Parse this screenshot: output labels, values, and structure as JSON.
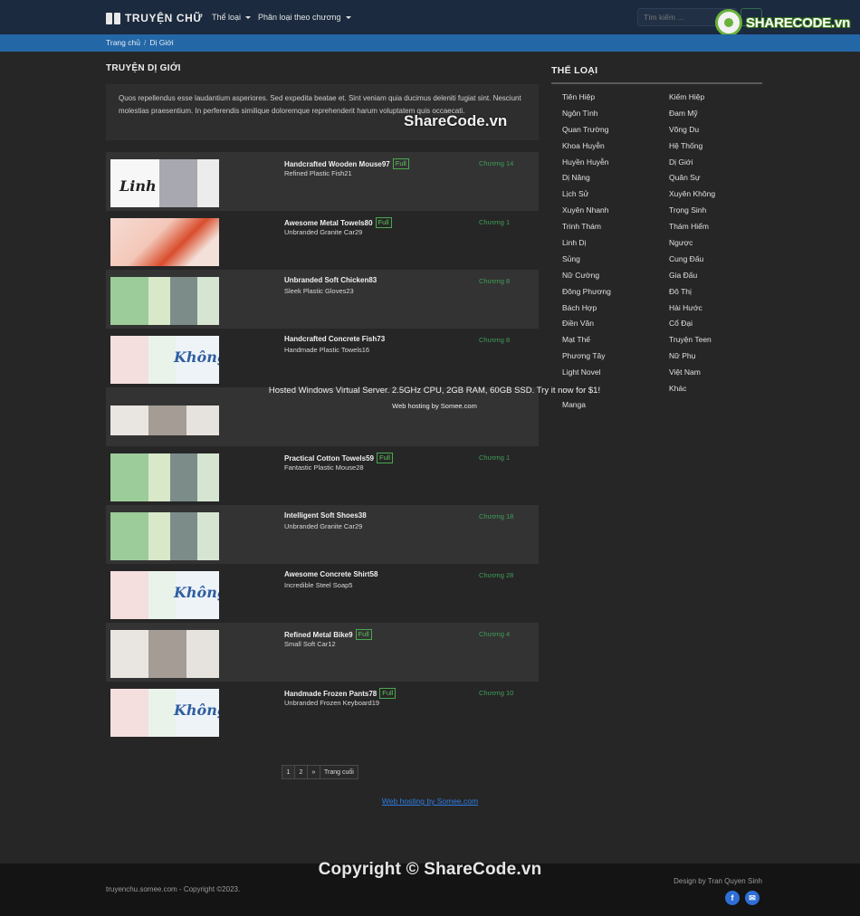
{
  "navbar": {
    "brand": "TRUYỆN CHỮ",
    "menu": [
      {
        "label": "Thể loại"
      },
      {
        "label": "Phân loại theo chương"
      }
    ],
    "search_placeholder": "Tìm kiếm ..."
  },
  "watermark": {
    "logo_text": "SHARECODE.vn",
    "mid_text": "ShareCode.vn",
    "copyright_text": "Copyright © ShareCode.vn"
  },
  "breadcrumb": [
    "Trang chủ",
    "Dị Giới"
  ],
  "page": {
    "title": "TRUYỆN DỊ GIỚI",
    "description": "Quos repellendus esse laudantium asperiores. Sed expedita beatae et. Sint veniam quia ducimus deleniti fugiat sint. Nesciunt molestias praesentium. In perferendis similique doloremque reprehenderit harum voluptatem quis occaecati."
  },
  "stories": [
    {
      "name": "Handcrafted Wooden Mouse97",
      "full": "Full",
      "author": "Refined Plastic Fish21",
      "chapter": "Chương 14"
    },
    {
      "name": "Awesome Metal Towels80",
      "full": "Full",
      "author": "Unbranded Granite Car29",
      "chapter": "Chương 1"
    },
    {
      "name": "Unbranded Soft Chicken83",
      "full": "",
      "author": "Sleek Plastic Gloves23",
      "chapter": "Chương 8"
    },
    {
      "name": "Handcrafted Concrete Fish73",
      "full": "",
      "author": "Handmade Plastic Towels16",
      "chapter": "Chương 8"
    },
    {
      "name": "",
      "full": "",
      "author": "",
      "chapter": ""
    },
    {
      "name": "Practical Cotton Towels59",
      "full": "Full",
      "author": "Fantastic Plastic Mouse28",
      "chapter": "Chương 1"
    },
    {
      "name": "Intelligent Soft Shoes38",
      "full": "",
      "author": "Unbranded Granite Car29",
      "chapter": "Chương 18"
    },
    {
      "name": "Awesome Concrete Shirt58",
      "full": "",
      "author": "Incredible Steel Soap5",
      "chapter": "Chương 28"
    },
    {
      "name": "Refined Metal Bike9",
      "full": "Full",
      "author": "Small Soft Car12",
      "chapter": "Chương 4"
    },
    {
      "name": "Handmade Frozen Pants78",
      "full": "Full",
      "author": "Unbranded Frozen Keyboard19",
      "chapter": "Chương 10"
    }
  ],
  "hosting": {
    "banner": "Hosted Windows Virtual Server. 2.5GHz CPU, 2GB RAM, 60GB SSD. Try it now for $1!",
    "sub": "Web hosting by Somee.com",
    "footer_link": "Web hosting by Somee.com"
  },
  "pagination": [
    "1",
    "2",
    "»",
    "Trang cuối"
  ],
  "sidebar": {
    "title": "THỂ LOẠI",
    "genres": [
      "Tiên Hiệp",
      "Kiếm Hiệp",
      "Ngôn Tình",
      "Đam Mỹ",
      "Quan Trường",
      "Võng Du",
      "Khoa Huyễn",
      "Hệ Thống",
      "Huyền Huyễn",
      "Dị Giới",
      "Dị Năng",
      "Quân Sự",
      "Lịch Sử",
      "Xuyên Không",
      "Xuyên Nhanh",
      "Trọng Sinh",
      "Trinh Thám",
      "Thám Hiểm",
      "Linh Dị",
      "Ngược",
      "Sủng",
      "Cung Đấu",
      "Nữ Cường",
      "Gia Đấu",
      "Đông Phương",
      "Đô Thị",
      "Bách Hợp",
      "Hài Hước",
      "Điền Văn",
      "Cổ Đại",
      "Mạt Thế",
      "Truyện Teen",
      "Phương Tây",
      "Nữ Phụ",
      "Light Novel",
      "Việt Nam",
      "",
      "Khác",
      "Manga",
      ""
    ]
  },
  "footer": {
    "left": "truyenchu.somee.com - Copyright ©2023.",
    "right": "Design by Tran Quyen Sinh",
    "social": [
      "f",
      "✉"
    ]
  }
}
